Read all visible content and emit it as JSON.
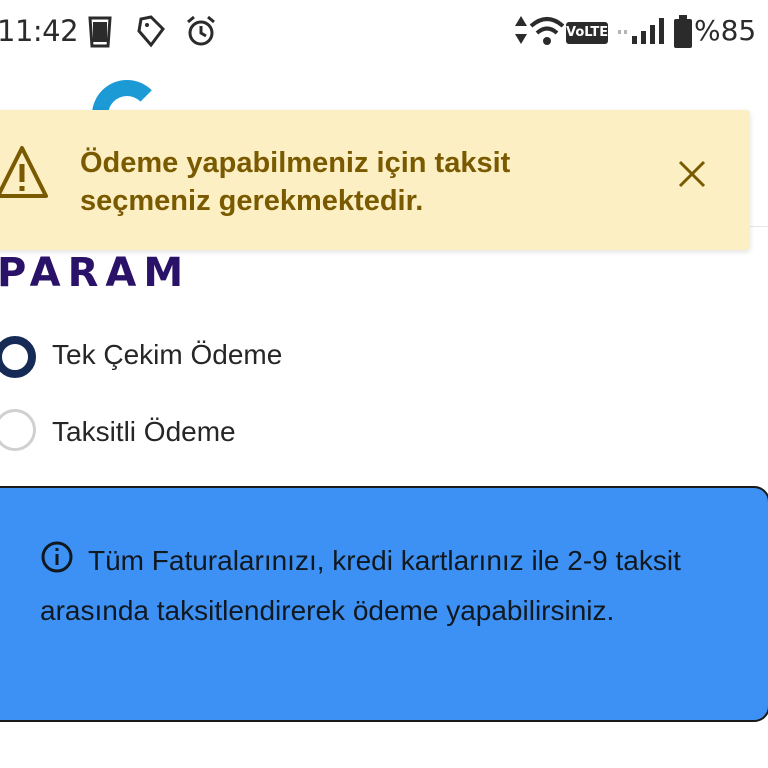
{
  "status_bar": {
    "time": "11:42",
    "left_icons": [
      "trash-icon",
      "tag-icon",
      "alarm-icon"
    ],
    "right_icons": [
      "data-arrows-icon",
      "wifi-icon",
      "volte-icon",
      "signal-icon",
      "battery-icon"
    ],
    "volte_label": "VoLTE",
    "battery": "%85"
  },
  "toast": {
    "message": "Ödeme yapabilmeniz için taksit seçmeniz gerekmektedir.",
    "color": "#fcefc4",
    "text_color": "#7a5a00"
  },
  "brand": {
    "name": "PARAM",
    "color": "#2a1269"
  },
  "payment_options": [
    {
      "label": "Tek Çekim Ödeme",
      "selected": true
    },
    {
      "label": "Taksitli Ödeme",
      "selected": false
    }
  ],
  "info": {
    "text": "Tüm Faturalarınızı, kredi kartlarınız ile 2-9 taksit arasında taksitlendirerek ödeme yapabilirsiniz.",
    "background": "#3e91f4"
  }
}
